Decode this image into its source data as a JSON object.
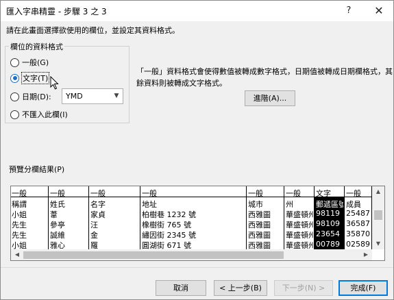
{
  "window": {
    "title": "匯入字串精靈 - 步驟 3 之 3",
    "help": "?",
    "close": "✕"
  },
  "instruction": "請在此畫面選擇欲使用的欄位，並設定其資料格式。",
  "format_group": {
    "legend": "欄位的資料格式",
    "options": [
      {
        "label": "一般(G)",
        "checked": false
      },
      {
        "label": "文字(T)",
        "checked": true
      },
      {
        "label": "日期(D):",
        "checked": false
      },
      {
        "label": "不匯入此欄(I)",
        "checked": false
      }
    ],
    "date_format": "YMD"
  },
  "description": "「一般」資料格式會使得數值被轉成數字格式，日期值被轉成日期欄格式，其餘資料則被轉成文字格式。",
  "advanced_button": "進階(A)...",
  "preview": {
    "label": "預覽分欄結果(P)",
    "headers": [
      "一般",
      "一般",
      "一般",
      "一般",
      "一般",
      "一般",
      "文字",
      "一般"
    ],
    "rows": [
      [
        "稱謂",
        "姓氏",
        "名字",
        "地址",
        "城市",
        "州",
        "郵遞區號",
        "成員"
      ],
      [
        "小姐",
        "葦",
        "家貞",
        "柏樹巷 1232 號",
        "西雅圖",
        "華盛頓州",
        "98119",
        "25487"
      ],
      [
        "先生",
        "參亭",
        "汪",
        "橡樹街 765 號",
        "西雅圖",
        "華盛頓州",
        "98109",
        "36587"
      ],
      [
        "先生",
        "誠維",
        "金",
        "繡因街 2345 號",
        "西雅圖",
        "華盛頓州",
        "23654",
        "35870"
      ],
      [
        "小姐",
        "雅心",
        "羅",
        "圓湖街 671 號",
        "西雅圖",
        "華盛頓州",
        "00789",
        "02589"
      ]
    ]
  },
  "buttons": {
    "cancel": "取消",
    "back": "< 上一步(B)",
    "next": "下一步(N) >",
    "finish": "完成(F)"
  }
}
